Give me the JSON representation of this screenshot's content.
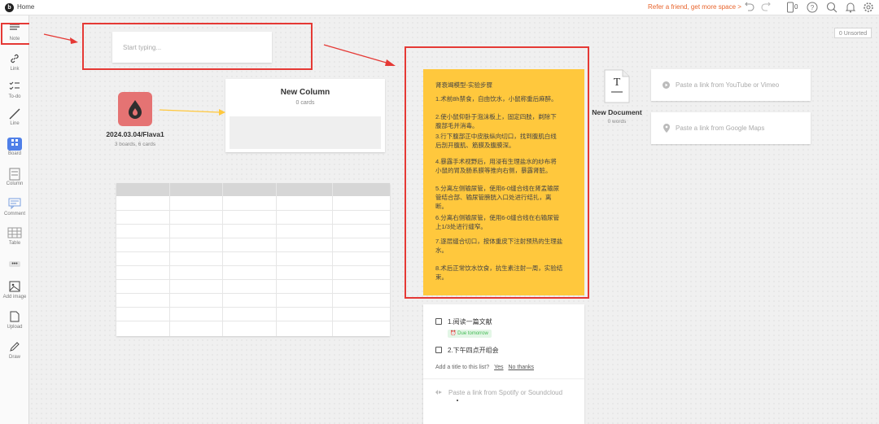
{
  "topbar": {
    "logo": "b",
    "home": "Home",
    "refer": "Refer a friend, get more space >",
    "device_count": "0",
    "help": "?"
  },
  "sidebar": {
    "items": [
      {
        "label": "Note",
        "icon": "note-icon"
      },
      {
        "label": "Link",
        "icon": "link-icon"
      },
      {
        "label": "To-do",
        "icon": "todo-icon"
      },
      {
        "label": "Line",
        "icon": "line-icon"
      },
      {
        "label": "Board",
        "icon": "board-icon"
      },
      {
        "label": "Column",
        "icon": "column-icon"
      },
      {
        "label": "Comment",
        "icon": "comment-icon"
      },
      {
        "label": "Table",
        "icon": "table-icon"
      },
      {
        "label": "Add image",
        "icon": "image-icon"
      },
      {
        "label": "Upload",
        "icon": "upload-icon"
      },
      {
        "label": "Draw",
        "icon": "draw-icon"
      }
    ],
    "more": "•••"
  },
  "canvas": {
    "unsorted": "0 Unsorted",
    "note_placeholder": "Start typing...",
    "board": {
      "title": "2024.03.04/Flava1",
      "subtitle": "3 boards, 6 cards"
    },
    "column": {
      "title": "New Column",
      "subtitle": "0 cards"
    },
    "sticky": {
      "lines": [
        "肾衰竭模型-实验步骤",
        "1.术前8h禁食，自由饮水，小鼠称重后麻醉。",
        "2.使小鼠仰卧于泡沫板上，固定四肢，剃除下",
        "腹部毛并消毒。",
        "3.行下腹部正中皮肤纵向切口，找到腹肌白线",
        "后剖开腹肌、筋膜及腹膜深。",
        "4.暴露手术视野后，用浸有生理盐水的纱布将",
        "小鼠的胃及肠系膜等推向右侧，暴露肾脏。",
        "5.分离左侧输尿管，使用6-0缝合线在肾盂输尿",
        "管结合部、输尿管膀胱入口处进行结扎，离",
        "断。",
        "6.分离右侧输尿管，使用6-0缝合线在右输尿管",
        "上1/3处进行缝窄。",
        "7.逐层缝合切口，按体重皮下注射预热的生理盐",
        "水。",
        "8.术后正常饮水饮食，抗生素注射一周，实验结",
        "束。"
      ]
    },
    "document": {
      "title": "New Document",
      "subtitle": "0 words",
      "glyph": "T"
    },
    "youtube_placeholder": "Paste a link from YouTube or Vimeo",
    "maps_placeholder": "Paste a link from Google Maps",
    "todo": {
      "items": [
        {
          "text": "1.阅读一篇文献",
          "due": "Due tomorrow"
        },
        {
          "text": "2.下午四点开组会"
        }
      ],
      "title_prompt": "Add a title to this list?",
      "yes": "Yes",
      "no": "No thanks"
    },
    "audio_placeholder": "Paste a link from Spotify or Soundcloud"
  },
  "colors": {
    "accent_red": "#e53935",
    "sticky_yellow": "#ffc83d",
    "board_tile": "#e57373",
    "refer_orange": "#e8642c",
    "due_green": "#3fb950"
  }
}
